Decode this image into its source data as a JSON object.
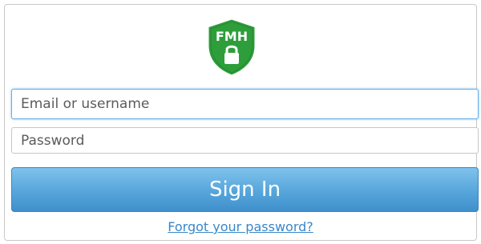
{
  "logo": {
    "text": "FMH",
    "icon": "shield-lock-logo",
    "shield_color": "#2e9e3b",
    "shield_border": "#ffffff",
    "lock_color": "#ffffff"
  },
  "login_form": {
    "email_placeholder": "Email or username",
    "email_value": "",
    "password_placeholder": "Password",
    "password_value": "",
    "signin_label": "Sign In",
    "forgot_link": "Forgot your password?"
  },
  "colors": {
    "button_top": "#7fc3ec",
    "button_bottom": "#3f8fcc",
    "link": "#3a87c8",
    "focus_border": "#66aee8"
  }
}
